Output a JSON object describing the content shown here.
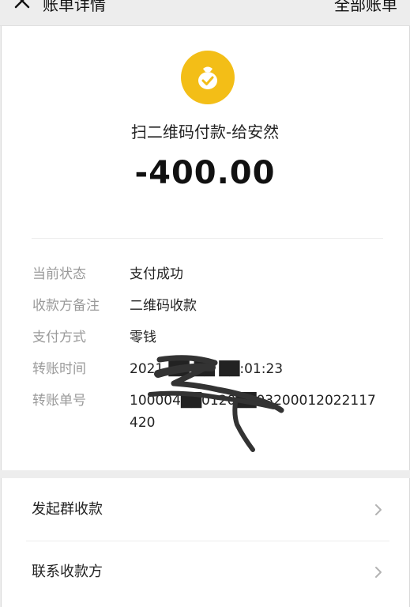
{
  "topbar": {
    "title": "账单详情",
    "right_link": "全部账单"
  },
  "summary": {
    "payee": "扫二维码付款-给安然",
    "amount": "-400.00"
  },
  "details": [
    {
      "label": "当前状态",
      "value": "支付成功"
    },
    {
      "label": "收款方备注",
      "value": "二维码收款"
    },
    {
      "label": "支付方式",
      "value": "零钱"
    },
    {
      "label": "转账时间",
      "value": "2021-██-██ ██:01:23"
    },
    {
      "label": "转账单号",
      "value": "100004██0120██03200012022117420"
    }
  ],
  "actions": [
    {
      "label": "发起群收款"
    },
    {
      "label": "联系收款方"
    }
  ],
  "colors": {
    "accent": "#f3be17",
    "background": "#ededed",
    "label_gray": "#9a9a9a"
  },
  "icons": {
    "close": "close-icon",
    "avatar": "money-bag-icon",
    "chevron": "chevron-right-icon"
  }
}
